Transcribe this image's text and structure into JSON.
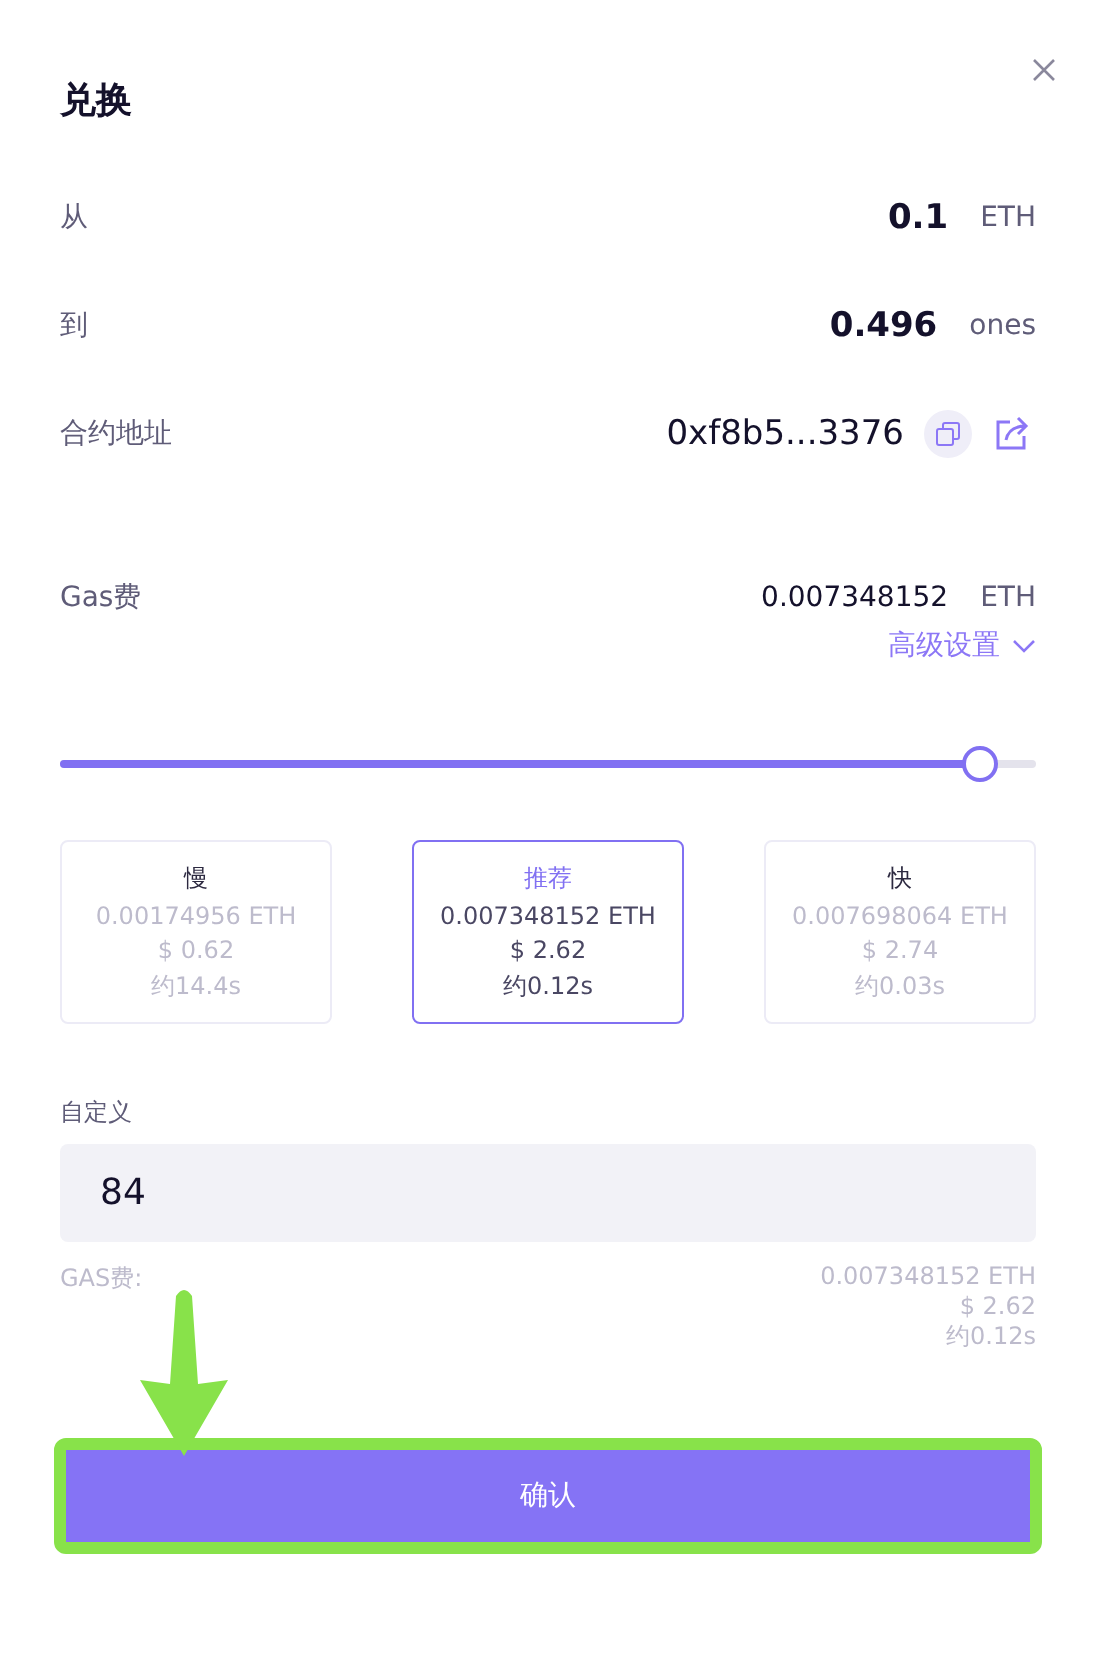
{
  "title": "兑换",
  "rows": [
    {
      "kind": "amount",
      "label": "从",
      "value": "0.1",
      "unit": "ETH"
    },
    {
      "kind": "amount",
      "label": "到",
      "value": "0.496",
      "unit": "ones"
    },
    {
      "kind": "address",
      "label": "合约地址",
      "value": "0xf8b5...3376"
    }
  ],
  "gas": {
    "label": "Gas费",
    "value": "0.007348152",
    "unit": "ETH",
    "advanced": "高级设置",
    "expanded": false,
    "level": 0.94
  },
  "speeds": [
    {
      "name": "慢",
      "eth": "0.00174956 ETH",
      "usd": "$ 0.62",
      "time": "约14.4s",
      "selected": false
    },
    {
      "name": "推荐",
      "eth": "0.007348152 ETH",
      "usd": "$ 2.62",
      "time": "约0.12s",
      "selected": true
    },
    {
      "name": "快",
      "eth": "0.007698064 ETH",
      "usd": "$ 2.74",
      "time": "约0.03s",
      "selected": false
    }
  ],
  "custom": {
    "label": "自定义",
    "value": "84"
  },
  "summary": {
    "label": "GAS费:",
    "lines": [
      "0.007348152 ETH",
      "$ 2.62",
      "约0.12s"
    ]
  },
  "confirm": {
    "label": "确认",
    "highlighted": true
  }
}
